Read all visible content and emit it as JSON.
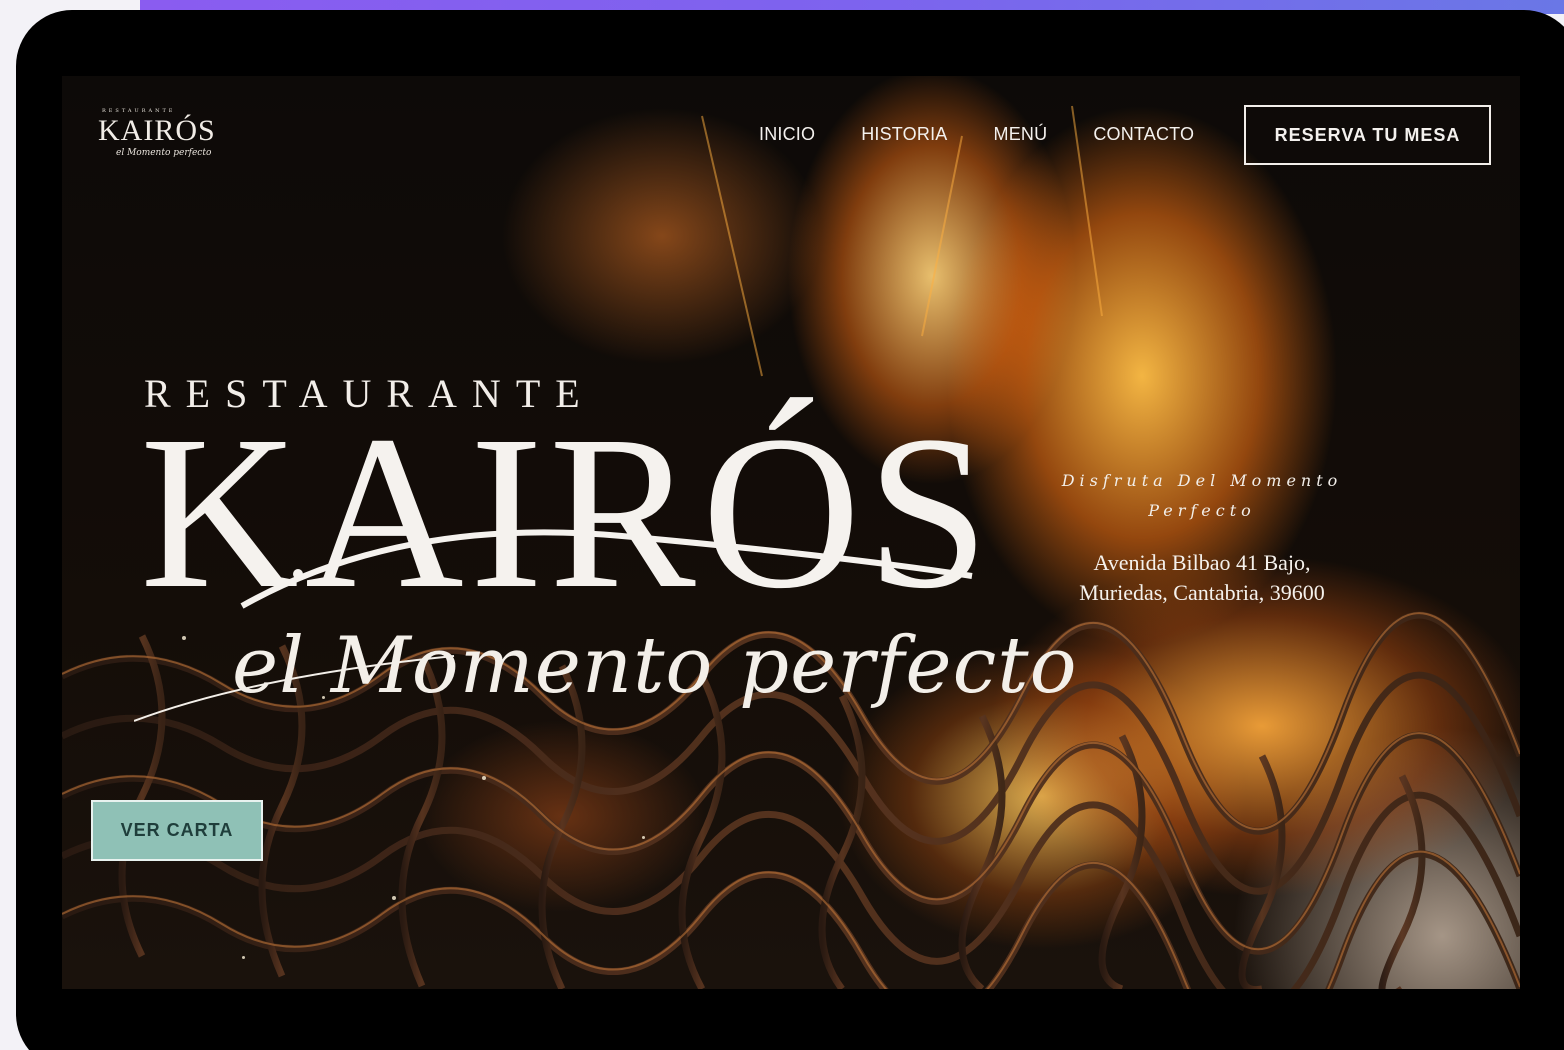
{
  "nav": {
    "logo_top": "RESTAURANTE",
    "logo_main": "KAIRÓS",
    "logo_script": "el Momento perfecto",
    "links": [
      "INICIO",
      "HISTORIA",
      "MENÚ",
      "CONTACTO"
    ],
    "cta": "RESERVA TU MESA"
  },
  "hero": {
    "title_top": "RESTAURANTE",
    "title_main": "KAIRÓS",
    "title_script": "el Momento perfecto",
    "tagline_line1": "Disfruta Del Momento",
    "tagline_line2": "Perfecto",
    "address_line1": "Avenida Bilbao 41 Bajo,",
    "address_line2": "Muriedas, Cantabria, 39600",
    "cta": "VER CARTA"
  },
  "colors": {
    "accent": "#8fc1b6",
    "frame": "#000000",
    "gradient_start": "#8a5cf0",
    "gradient_end": "#6a77e6"
  }
}
